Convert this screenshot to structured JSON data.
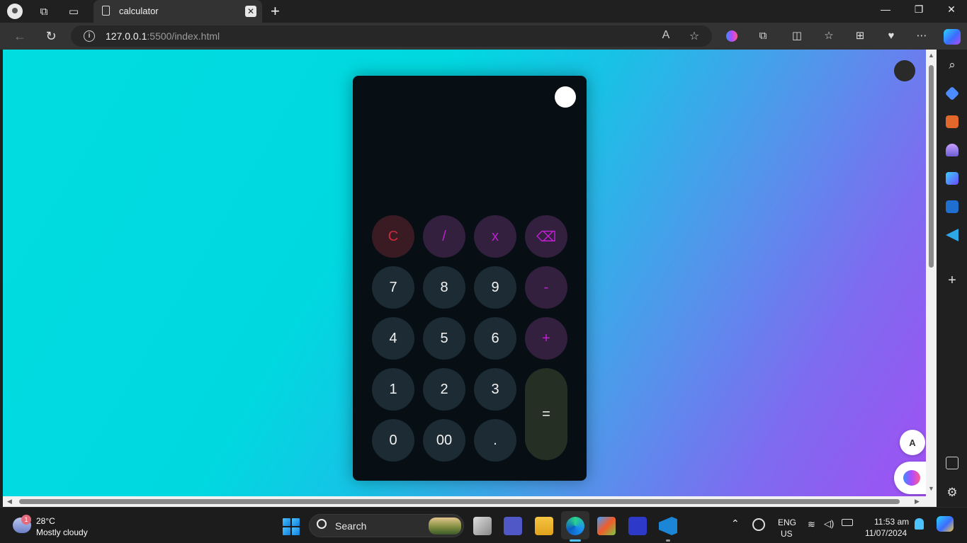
{
  "browser": {
    "tab": {
      "title": "calculator",
      "close_label": "✕"
    },
    "new_tab_label": "+",
    "address": {
      "url_host": "127.0.0.1",
      "url_rest": ":5500/index.html"
    },
    "window_controls": {
      "minimize": "—",
      "restore": "❐",
      "close": "✕"
    },
    "nav": {
      "back": "←",
      "refresh": "↻"
    },
    "addr_icons": {
      "read_aloud": "A",
      "favorite": "☆"
    },
    "toolbar_icons": {
      "extensions": "⧉",
      "split": "◫",
      "favorites": "☆",
      "collections": "⊞",
      "health": "♥",
      "more": "⋯"
    },
    "sidebar": {
      "search": "⌕",
      "add": "+",
      "settings": "⚙"
    }
  },
  "calculator": {
    "display_value": "",
    "keys": [
      {
        "label": "C",
        "kind": "clear"
      },
      {
        "label": "/",
        "kind": "op"
      },
      {
        "label": "x",
        "kind": "op"
      },
      {
        "label": "⌫",
        "kind": "op"
      },
      {
        "label": "7",
        "kind": "num"
      },
      {
        "label": "8",
        "kind": "num"
      },
      {
        "label": "9",
        "kind": "num"
      },
      {
        "label": "-",
        "kind": "op"
      },
      {
        "label": "4",
        "kind": "num"
      },
      {
        "label": "5",
        "kind": "num"
      },
      {
        "label": "6",
        "kind": "num"
      },
      {
        "label": "+",
        "kind": "op"
      },
      {
        "label": "1",
        "kind": "num"
      },
      {
        "label": "2",
        "kind": "num"
      },
      {
        "label": "3",
        "kind": "num"
      },
      {
        "label": "0",
        "kind": "num"
      },
      {
        "label": "00",
        "kind": "num"
      },
      {
        "label": ".",
        "kind": "num"
      },
      {
        "label": "=",
        "kind": "eq"
      }
    ]
  },
  "floating": {
    "translate_label": "A"
  },
  "taskbar": {
    "weather": {
      "temp": "28°C",
      "desc": "Mostly cloudy",
      "badge": "1"
    },
    "search_label": "Search",
    "language": {
      "line1": "ENG",
      "line2": "US"
    },
    "clock": {
      "time": "11:53 am",
      "date": "11/07/2024"
    }
  },
  "colors": {
    "page_gradient_start": "#00dde0",
    "page_gradient_end": "#a050f2",
    "calculator_bg": "#070e14",
    "number_key": "#1d2b34",
    "operator_key": "#33203f",
    "operator_text": "#c01fd0",
    "clear_text": "#d0283d",
    "equals_key": "#252f24"
  }
}
